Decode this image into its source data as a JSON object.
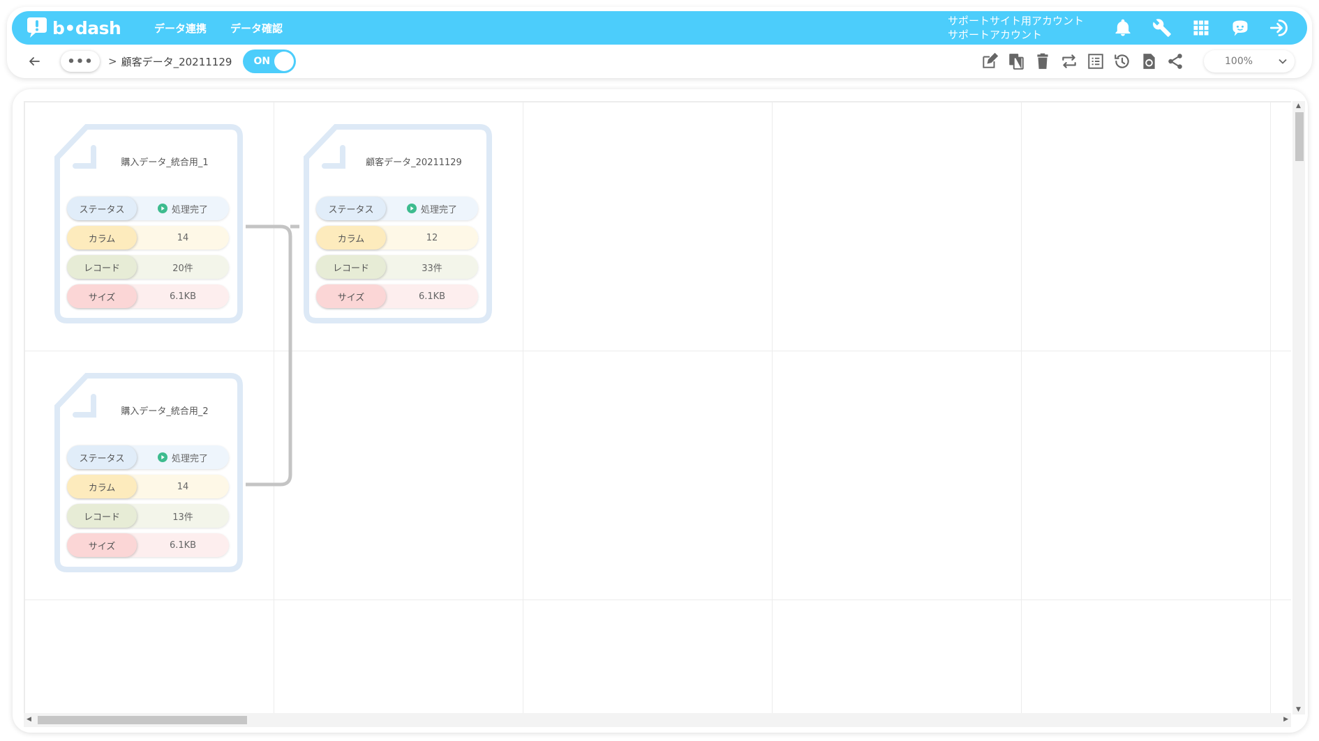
{
  "header": {
    "logo_text": "b•dash",
    "nav": [
      "データ連携",
      "データ確認"
    ],
    "account_line1": "サポートサイト用アカウント",
    "account_line2": "サポートアカウント",
    "accent_color": "#4ccdfb"
  },
  "subbar": {
    "more_label": "•••",
    "separator": ">",
    "breadcrumb": "顧客データ_20211129",
    "toggle_label": "ON",
    "zoom": "100%"
  },
  "labels": {
    "status": "ステータス",
    "column": "カラム",
    "record": "レコード",
    "size": "サイズ"
  },
  "nodes": [
    {
      "title": "購入データ_統合用_1",
      "status": "処理完了",
      "columns": "14",
      "records": "20件",
      "size": "6.1KB"
    },
    {
      "title": "顧客データ_20211129",
      "status": "処理完了",
      "columns": "12",
      "records": "33件",
      "size": "6.1KB"
    },
    {
      "title": "購入データ_統合用_2",
      "status": "処理完了",
      "columns": "14",
      "records": "13件",
      "size": "6.1KB"
    }
  ]
}
